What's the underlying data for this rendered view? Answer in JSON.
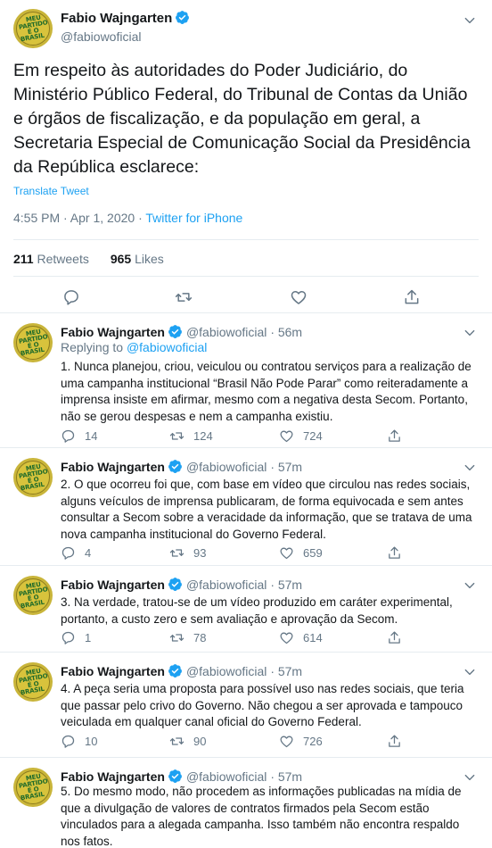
{
  "main_tweet": {
    "author_name": "Fabio Wajngarten",
    "author_handle": "@fabiowoficial",
    "avatar_text": [
      "MEU",
      "PARTIDO",
      "É O",
      "BRASIL"
    ],
    "text": "Em respeito às autoridades do Poder Judiciário, do Ministério Público Federal, do Tribunal de Contas da União  e órgãos de fiscalização, e da população em geral, a Secretaria Especial de Comunicação Social da Presidência da República esclarece:",
    "translate_label": "Translate Tweet",
    "timestamp": "4:55 PM · Apr 1, 2020 · ",
    "source": "Twitter for iPhone",
    "retweets_count": "211",
    "retweets_label": "Retweets",
    "likes_count": "965",
    "likes_label": "Likes"
  },
  "replies": [
    {
      "author_name": "Fabio Wajngarten",
      "author_handle": "@fabiowoficial",
      "time": "· 56m",
      "replying_to_label": "Replying to ",
      "replying_to_handle": "@fabiowoficial",
      "text": "1. Nunca planejou, criou, veiculou ou contratou serviços para a realização de uma campanha institucional “Brasil Não Pode Parar” como reiteradamente a imprensa insiste em afirmar, mesmo com a negativa desta Secom. Portanto, não se gerou despesas e nem a campanha existiu.",
      "replies": "14",
      "retweets": "124",
      "likes": "724"
    },
    {
      "author_name": "Fabio Wajngarten",
      "author_handle": "@fabiowoficial",
      "time": "· 57m",
      "text": "2. O que ocorreu foi que, com base em vídeo que circulou nas redes sociais, alguns veículos de imprensa publicaram, de forma equivocada e sem antes consultar a Secom sobre a veracidade da informação, que se tratava de uma nova campanha institucional do Governo Federal.",
      "replies": "4",
      "retweets": "93",
      "likes": "659"
    },
    {
      "author_name": "Fabio Wajngarten",
      "author_handle": "@fabiowoficial",
      "time": "· 57m",
      "text": "3. Na verdade, tratou-se de um vídeo produzido em caráter experimental, portanto, a custo zero e sem avaliação e aprovação da Secom.",
      "replies": "1",
      "retweets": "78",
      "likes": "614"
    },
    {
      "author_name": "Fabio Wajngarten",
      "author_handle": "@fabiowoficial",
      "time": "· 57m",
      "text": "4. A peça seria uma proposta para possível uso nas redes sociais, que teria que passar pelo crivo do Governo. Não chegou a ser aprovada e tampouco veiculada em qualquer canal oficial do Governo Federal.",
      "replies": "10",
      "retweets": "90",
      "likes": "726"
    },
    {
      "author_name": "Fabio Wajngarten",
      "author_handle": "@fabiowoficial",
      "time": "· 57m",
      "text": "5. Do mesmo modo, não procedem as informações publicadas na mídia de que a divulgação de valores de contratos firmados pela Secom estão vinculados para a alegada campanha. Isso também não encontra respaldo nos fatos."
    }
  ],
  "colors": {
    "accent": "#1da1f2",
    "secondary_text": "#657786",
    "divider": "#e6ecf0"
  },
  "icons": [
    "verified-badge-icon",
    "chevron-down-icon",
    "reply-icon",
    "retweet-icon",
    "like-icon",
    "share-icon"
  ]
}
